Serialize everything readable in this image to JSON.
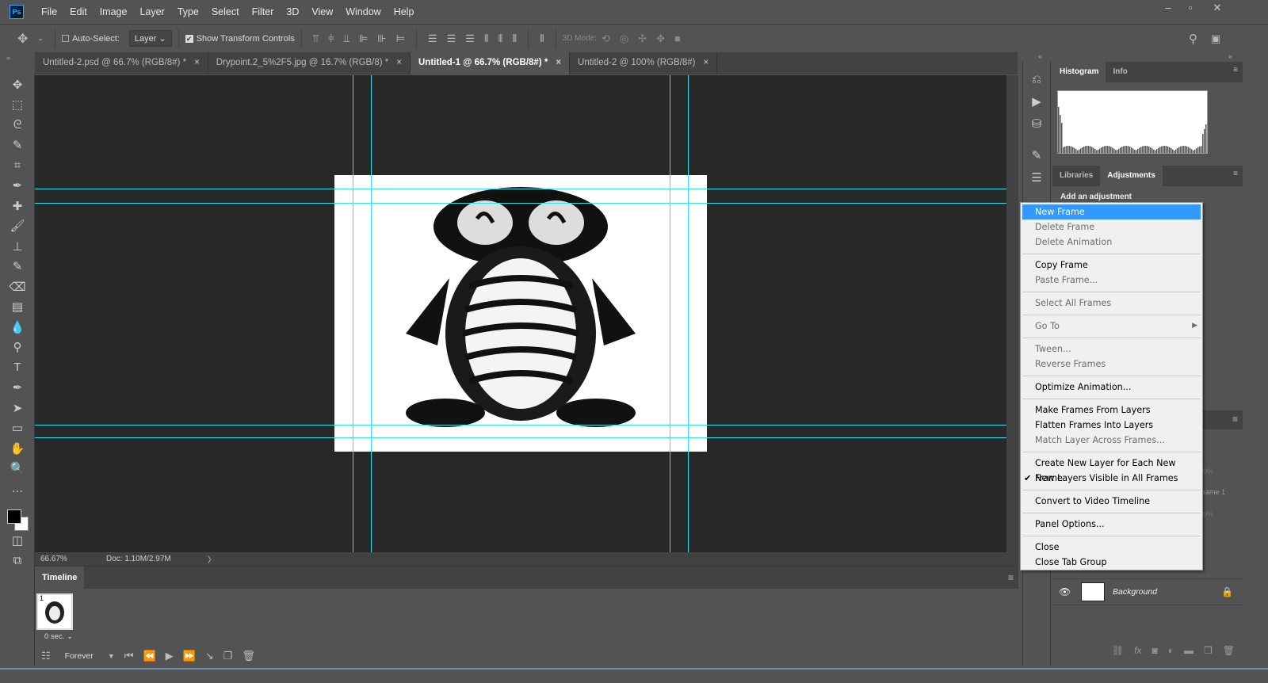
{
  "app": {
    "logo": "Ps"
  },
  "menu": [
    "File",
    "Edit",
    "Image",
    "Layer",
    "Type",
    "Select",
    "Filter",
    "3D",
    "View",
    "Window",
    "Help"
  ],
  "window_controls": {
    "minimize": "–",
    "maximize": "▫",
    "close": "✕"
  },
  "options": {
    "auto_select_label": "Auto-Select:",
    "auto_select_checked": false,
    "layer_select": "Layer",
    "show_transform_label": "Show Transform Controls",
    "show_transform_checked": true,
    "mode_3d_label": "3D Mode:"
  },
  "tabs": [
    {
      "label": "Untitled-2.psd @ 66.7% (RGB/8#) *",
      "active": false
    },
    {
      "label": "Drypoint.2_5%2F5.jpg @ 16.7% (RGB/8) *",
      "active": false
    },
    {
      "label": "Untitled-1 @ 66.7% (RGB/8#) *",
      "active": true
    },
    {
      "label": "Untitled-2 @ 100% (RGB/8#)",
      "active": false
    }
  ],
  "tab_close": "×",
  "status": {
    "zoom": "66.67%",
    "doc": "Doc: 1.10M/2.97M",
    "arrow": "〉"
  },
  "timeline": {
    "tab": "Timeline",
    "frame_number": "1",
    "frame_delay": "0 sec.",
    "loop": "Forever"
  },
  "right_panel": {
    "top_tabs": [
      "Histogram",
      "Info"
    ],
    "mid_tabs": [
      "Libraries",
      "Adjustments"
    ],
    "add_adjustment": "Add an adjustment",
    "layer_name": "Background",
    "partial_texts": [
      "0%",
      "rame 1",
      "0%"
    ]
  },
  "context_menu": {
    "groups": [
      [
        {
          "label": "New Frame",
          "state": "highlighted"
        },
        {
          "label": "Delete Frame",
          "state": "disabled"
        },
        {
          "label": "Delete Animation",
          "state": "disabled"
        }
      ],
      [
        {
          "label": "Copy Frame",
          "state": "enabled"
        },
        {
          "label": "Paste Frame...",
          "state": "disabled"
        }
      ],
      [
        {
          "label": "Select All Frames",
          "state": "disabled"
        }
      ],
      [
        {
          "label": "Go To",
          "state": "disabled",
          "submenu": true
        }
      ],
      [
        {
          "label": "Tween...",
          "state": "disabled"
        },
        {
          "label": "Reverse Frames",
          "state": "disabled"
        }
      ],
      [
        {
          "label": "Optimize Animation...",
          "state": "enabled"
        }
      ],
      [
        {
          "label": "Make Frames From Layers",
          "state": "enabled"
        },
        {
          "label": "Flatten Frames Into Layers",
          "state": "enabled"
        },
        {
          "label": "Match Layer Across Frames...",
          "state": "disabled"
        }
      ],
      [
        {
          "label": "Create New Layer for Each New Frame",
          "state": "enabled"
        },
        {
          "label": "New Layers Visible in All Frames",
          "state": "enabled",
          "checked": true
        }
      ],
      [
        {
          "label": "Convert to Video Timeline",
          "state": "enabled"
        }
      ],
      [
        {
          "label": "Panel Options...",
          "state": "enabled"
        }
      ],
      [
        {
          "label": "Close",
          "state": "enabled"
        },
        {
          "label": "Close Tab Group",
          "state": "enabled"
        }
      ]
    ]
  },
  "colors": {
    "guide": "#2ee6f2",
    "highlight": "#3399ff",
    "canvas_bg": "#282828",
    "panel_bg": "#535353"
  }
}
